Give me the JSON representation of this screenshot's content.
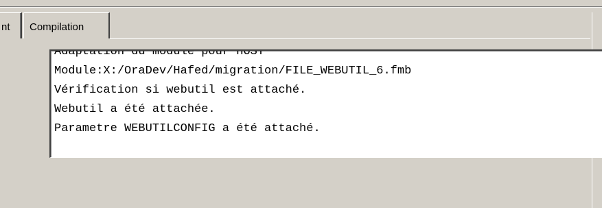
{
  "tabs": [
    {
      "label": "nt"
    },
    {
      "label": "Compilation"
    }
  ],
  "log": {
    "lines": [
      "Adaptation du module pour HOST",
      "Module:X:/OraDev/Hafed/migration/FILE_WEBUTIL_6.fmb",
      "Vérification si webutil est attaché.",
      "Webutil a été attachée.",
      "Parametre WEBUTILCONFIG a été attaché."
    ]
  }
}
